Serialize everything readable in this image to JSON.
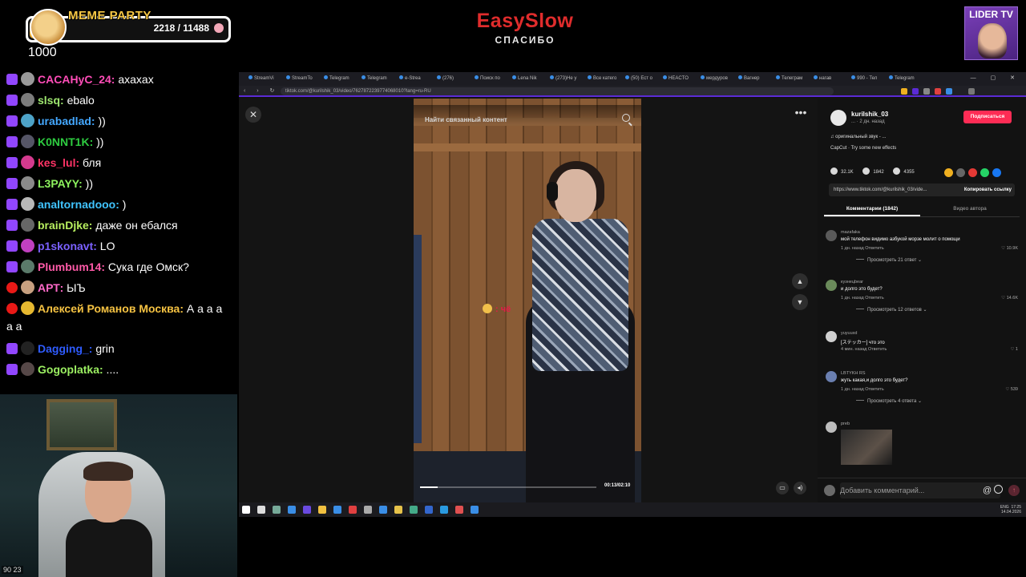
{
  "overlay": {
    "goal": {
      "title": "MEME PARTY",
      "count": "2218 / 11488",
      "progress": 0.193,
      "sub": "1000"
    },
    "brand": {
      "title": "EasySlow",
      "subtitle": "СПАСИБО"
    },
    "badge": {
      "title": "LIDER TV"
    }
  },
  "chat": {
    "messages": [
      {
        "user": "CACAHyC_24:",
        "text": " axaxax",
        "color": "#ff4db8",
        "badge": "sub"
      },
      {
        "user": "slsq:",
        "text": " ebalo",
        "color": "#9fe870",
        "badge": "sub"
      },
      {
        "user": "urabadlad:",
        "text": " ))",
        "color": "#44a8ff",
        "badge": "sub"
      },
      {
        "user": "K0NNT1K:",
        "text": " ))",
        "color": "#2ecc40",
        "badge": "sub"
      },
      {
        "user": "kes_lul:",
        "text": " бля",
        "color": "#ff3366",
        "badge": "sub"
      },
      {
        "user": "L3PAYY:",
        "text": " ))",
        "color": "#8df25e",
        "badge": "sub"
      },
      {
        "user": "analtornadooo:",
        "text": " )",
        "color": "#40c4ff",
        "badge": "sub"
      },
      {
        "user": "brainDjke:",
        "text": " даже он ебался",
        "color": "#b8f060",
        "badge": "sub"
      },
      {
        "user": "p1skonavt:",
        "text": " LO",
        "color": "#7b61ff",
        "badge": "sub"
      },
      {
        "user": "Plumbum14:",
        "text": " Сука где Омск?",
        "color": "#ff5aa8",
        "badge": "sub"
      },
      {
        "user": "АРТ:",
        "text": " ЫЪ",
        "color": "#ff69c8",
        "badge": "live"
      },
      {
        "user": "Алексей Романов Москва:",
        "text": " А а а а",
        "text2": "а а",
        "color": "#f5c242",
        "badge": "live"
      },
      {
        "user": "Dagging_:",
        "text": " grin",
        "color": "#2f5cff",
        "badge": "sub"
      },
      {
        "user": "Gogoplatka:",
        "text": " ....",
        "color": "#9cf062",
        "badge": "sub"
      }
    ],
    "webcam_label": "90 23"
  },
  "browser": {
    "tabs": [
      "StreamVi",
      "StreamTo",
      "Telegram",
      "Telegram",
      "e-Strea",
      "(276)",
      "Поиск по",
      "Lena Nik",
      "(273)Не у",
      "Все катего",
      "(50) Ест о",
      "HEACTO",
      "мердуров",
      "Вагнер",
      "Телеграм",
      "нагав",
      "990 - Тел",
      "Telegram"
    ],
    "url": "tiktok.com/@kurilshik_03/video/7627872239774068010?lang=ru-RU",
    "video": {
      "search_placeholder": "Найти связанный контент",
      "sticker_text": ": чё",
      "time": "00:13/02:10",
      "progress": 0.1
    },
    "panel": {
      "username": "kurilshik_03",
      "date": "... · 2 дн. назад",
      "follow": "Подписаться",
      "sound": "♫  оригинальный звук - ...",
      "effect": "CapCut · Try some new effects",
      "likes": "32.1K",
      "comments": "1842",
      "saves": "4355",
      "link": "https://www.tiktok.com/@kurilshik_03/vide...",
      "copy": "Копировать ссылку",
      "tab_comments": "Комментарии (1842)",
      "tab_author": "Видео автора"
    },
    "comments": [
      {
        "user": "mazafaka",
        "text": "мой телефон видимо азбукой морзе молит о помощи",
        "meta": "1 дн. назад    Ответить",
        "likes": "♡ 10.9K",
        "replies": "Просмотреть 21 ответ ⌄"
      },
      {
        "user": "кузнецbear",
        "text": "и долго это будет?",
        "meta": "1 дн. назад    Ответить",
        "likes": "♡ 14.6K",
        "replies": "Просмотреть 12 ответов ⌄"
      },
      {
        "user": "yuyuuxd",
        "text": "[ステッカー] что это",
        "meta": "4 мин. назад    Ответить",
        "likes": "♡ 1",
        "replies": ""
      },
      {
        "user": "LBTYKH RS",
        "text": "жуть какая,и долго это будет?",
        "meta": "1 дн. назад    Ответить",
        "likes": "♡ 539",
        "replies": "Просмотреть 4 ответа ⌄"
      },
      {
        "user": "preb",
        "text": "",
        "meta": "",
        "likes": "",
        "replies": ""
      }
    ],
    "composer_placeholder": "Добавить комментарий...",
    "tray": {
      "lang": "ENG",
      "time": "17:25",
      "date": "14.04.2026"
    }
  }
}
